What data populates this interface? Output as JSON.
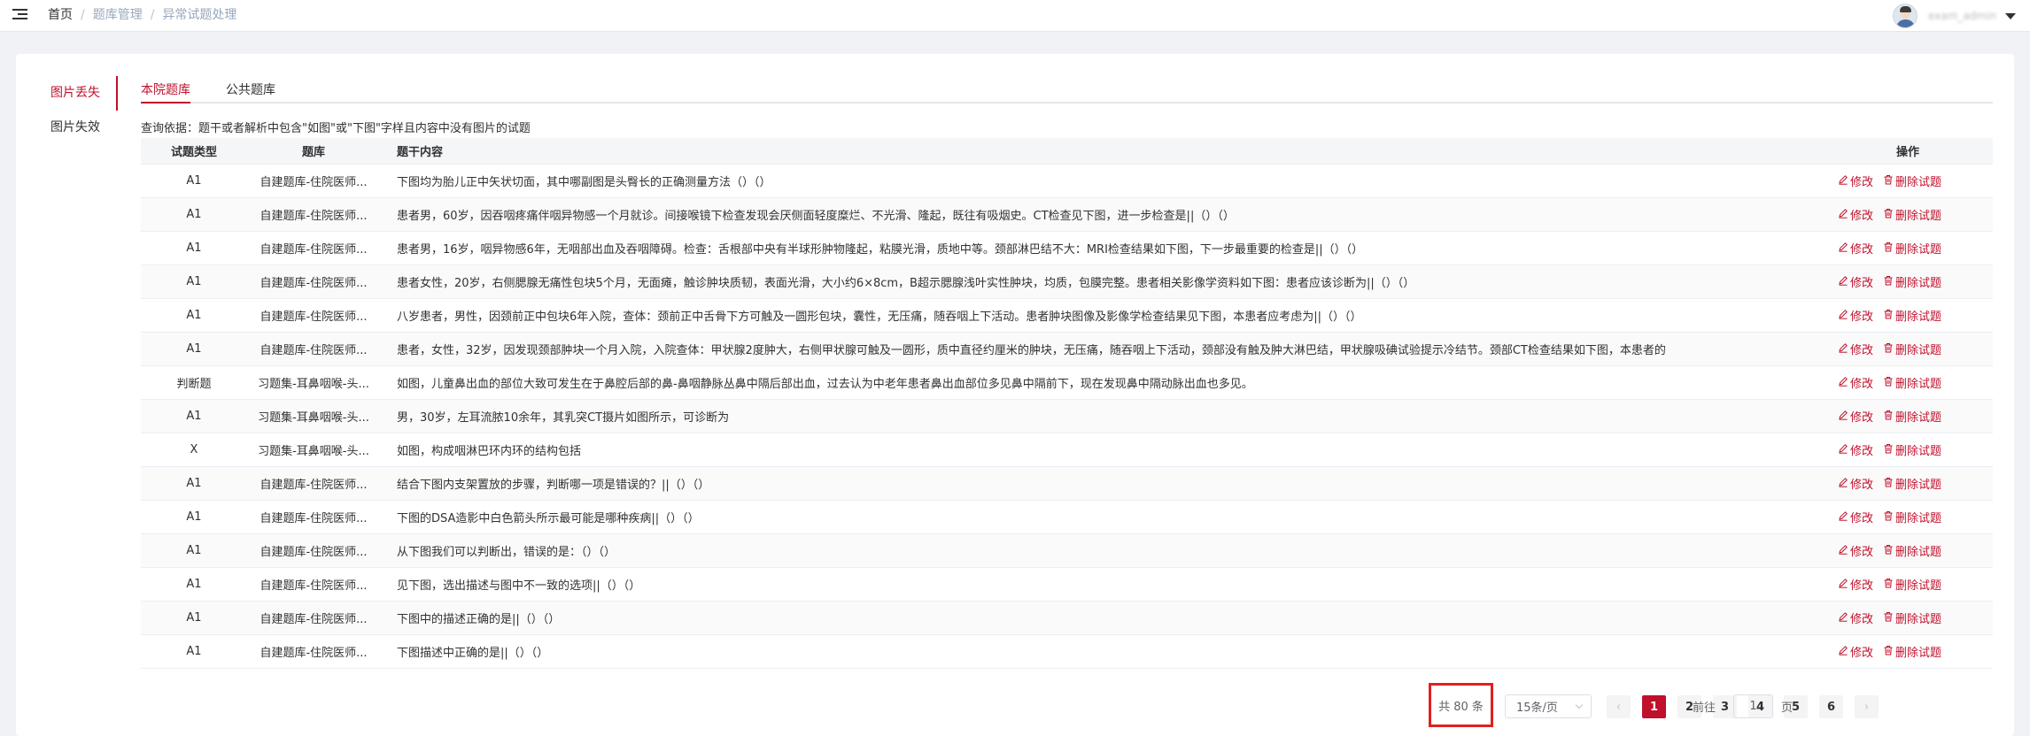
{
  "navbar": {
    "breadcrumb": [
      "首页",
      "题库管理",
      "异常试题处理"
    ],
    "username": "exam_admin"
  },
  "side_tabs": [
    "图片丢失",
    "图片失效"
  ],
  "top_tabs": [
    "本院题库",
    "公共题库"
  ],
  "hint": "查询依据：题干或者解析中包含\"如图\"或\"下图\"字样且内容中没有图片的试题",
  "table": {
    "headers": {
      "type": "试题类型",
      "bank": "题库",
      "content": "题干内容",
      "ops": "操作"
    },
    "edit_label": "修改",
    "delete_label": "删除试题",
    "rows": [
      {
        "type": "A1",
        "bank": "自建题库-住院医师...",
        "content": "下图均为胎儿正中矢状切面，其中哪副图是头臀长的正确测量方法（）（）"
      },
      {
        "type": "A1",
        "bank": "自建题库-住院医师...",
        "content": "患者男，60岁，因吞咽疼痛伴咽异物感一个月就诊。间接喉镜下检查发现会厌侧面轻度糜烂、不光滑、隆起，既往有吸烟史。CT检查见下图，进一步检查是||（）（）"
      },
      {
        "type": "A1",
        "bank": "自建题库-住院医师...",
        "content": "患者男，16岁，咽异物感6年，无咽部出血及吞咽障碍。检查：舌根部中央有半球形肿物隆起，粘膜光滑，质地中等。颈部淋巴结不大：MRI检查结果如下图，下一步最重要的检查是||（）（）"
      },
      {
        "type": "A1",
        "bank": "自建题库-住院医师...",
        "content": "患者女性，20岁，右侧腮腺无痛性包块5个月，无面瘫，触诊肿块质韧，表面光滑，大小约6×8cm，B超示腮腺浅叶实性肿块，均质，包膜完整。患者相关影像学资料如下图：患者应该诊断为||（）（）"
      },
      {
        "type": "A1",
        "bank": "自建题库-住院医师...",
        "content": "八岁患者，男性，因颈前正中包块6年入院，查体：颈前正中舌骨下方可触及一圆形包块，囊性，无压痛，随吞咽上下活动。患者肿块图像及影像学检查结果见下图，本患者应考虑为||（）（）"
      },
      {
        "type": "A1",
        "bank": "自建题库-住院医师...",
        "content": "患者，女性，32岁，因发现颈部肿块一个月入院，入院查体：甲状腺2度肿大，右侧甲状腺可触及一圆形，质中直径约厘米的肿块，无压痛，随吞咽上下活动，颈部没有触及肿大淋巴结，甲状腺吸碘试验提示冷结节。颈部CT检查结果如下图，本患者的"
      },
      {
        "type": "判断题",
        "bank": "习题集-耳鼻咽喉-头...",
        "content": "如图，儿童鼻出血的部位大致可发生在于鼻腔后部的鼻-鼻咽静脉丛鼻中隔后部出血，过去认为中老年患者鼻出血部位多见鼻中隔前下，现在发现鼻中隔动脉出血也多见。"
      },
      {
        "type": "A1",
        "bank": "习题集-耳鼻咽喉-头...",
        "content": "男，30岁，左耳流脓10余年，其乳突CT摄片如图所示，可诊断为"
      },
      {
        "type": "X",
        "bank": "习题集-耳鼻咽喉-头...",
        "content": "如图，构成咽淋巴环内环的结构包括"
      },
      {
        "type": "A1",
        "bank": "自建题库-住院医师...",
        "content": "结合下图内支架置放的步骤，判断哪一项是错误的？||（）（）"
      },
      {
        "type": "A1",
        "bank": "自建题库-住院医师...",
        "content": "下图的DSA造影中白色箭头所示最可能是哪种疾病||（）（）"
      },
      {
        "type": "A1",
        "bank": "自建题库-住院医师...",
        "content": "从下图我们可以判断出，错误的是：（）（）"
      },
      {
        "type": "A1",
        "bank": "自建题库-住院医师...",
        "content": "见下图，选出描述与图中不一致的选项||（）（）"
      },
      {
        "type": "A1",
        "bank": "自建题库-住院医师...",
        "content": "下图中的描述正确的是||（）（）"
      },
      {
        "type": "A1",
        "bank": "自建题库-住院医师...",
        "content": "下图描述中正确的是||（）（）"
      }
    ]
  },
  "pagination": {
    "total_label": "共 80 条",
    "page_size": "15条/页",
    "pages": [
      "1",
      "2",
      "3",
      "4",
      "5",
      "6"
    ],
    "current_page": "1",
    "goto_label": "前往",
    "goto_value": "1",
    "page_unit": "页"
  },
  "colors": {
    "accent": "#c0102c",
    "highlight_border": "#e02020"
  }
}
